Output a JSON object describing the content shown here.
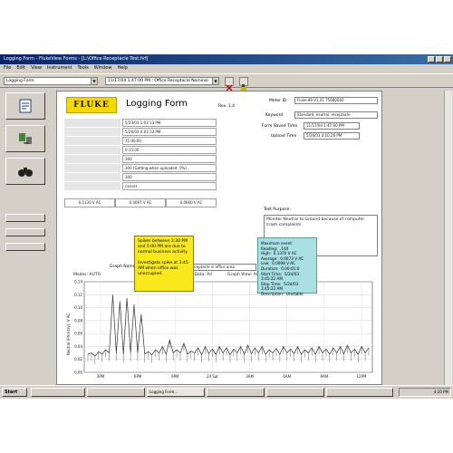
{
  "window": {
    "title": "Logging Form - FlukeView Forms - [L:\\Office Receptacle Test.fvf]"
  },
  "menu": [
    "File",
    "Edit",
    "View",
    "Instrument",
    "Tools",
    "Window",
    "Help"
  ],
  "toolbar": {
    "form_select": "Logging Form",
    "record_select": "11/17/04 1:47:00 PM : Office Receptacle Nominal"
  },
  "form": {
    "brand": "FLUKE",
    "title": "Logging Form",
    "revision": "Rev. 1.4",
    "fields": [
      {
        "label": "",
        "value": "5/23/03 1:03:13 PM"
      },
      {
        "label": "",
        "value": "5/26/03 4:03:13 PM"
      },
      {
        "label": "",
        "value": "71:00:00"
      },
      {
        "label": "",
        "value": "0:15:00"
      },
      {
        "label": "",
        "value": "300"
      },
      {
        "label": "",
        "value": "300     (Getting when uploaded: 0%)"
      },
      {
        "label": "",
        "value": "300"
      },
      {
        "label": "",
        "value": "(none)"
      }
    ],
    "stats": [
      "0.1130 V AC",
      "0.0097 V AC",
      "0.0660 V AC"
    ],
    "meter_id_label": "Meter ID",
    "meter_id": "Fluke 89   V1.01   75660040",
    "keyword_label": "Keyword",
    "keyword": "Standard, neutral, receptacle",
    "form_saved_label": "Form Saved Time",
    "form_saved": "11/17/04 1:47:00 PM",
    "upload_label": "Upload Time",
    "upload": "5/26/03 4:10:26 PM",
    "purpose_label": "Test Purpose:",
    "purpose": "Monitor Neutral to Ground because of computer crash complaints",
    "graph_name_label": "Graph Name:",
    "graph_name": "Neutral to Ground Volts on receptacle in office area",
    "graph_meta_left": "Modes:  AUTO",
    "graph_meta_mid": "Show Data: All",
    "graph_meta_right": "Graph View: All"
  },
  "chart_data": {
    "type": "line",
    "title": "",
    "xlabel": "",
    "ylabel": "Neutral (Primary), V AC",
    "ylim": [
      0.0,
      0.14
    ],
    "yticks": [
      "0.14",
      "0.12",
      "0.10",
      "0.08",
      "0.06",
      "0.04",
      "0.02",
      "0.00"
    ],
    "xticks": [
      "3PM",
      "6PM",
      "9PM",
      "24 Sat",
      "3AM",
      "6AM",
      "9AM",
      "12PM"
    ],
    "series": [
      {
        "name": "",
        "values": [
          0.028,
          0.03,
          0.025,
          0.032,
          0.028,
          0.035,
          0.03,
          0.12,
          0.03,
          0.11,
          0.028,
          0.115,
          0.03,
          0.105,
          0.03,
          0.09,
          0.028,
          0.032,
          0.027,
          0.035,
          0.03,
          0.04,
          0.028,
          0.05,
          0.03,
          0.035,
          0.03,
          0.045,
          0.028,
          0.033,
          0.03,
          0.038,
          0.027,
          0.04,
          0.029,
          0.036,
          0.028,
          0.04,
          0.03,
          0.038,
          0.027,
          0.036,
          0.03,
          0.04,
          0.028,
          0.042,
          0.029,
          0.038,
          0.03,
          0.04,
          0.028,
          0.035,
          0.03,
          0.037,
          0.028,
          0.04,
          0.03,
          0.036,
          0.029,
          0.04,
          0.028,
          0.035,
          0.03,
          0.038,
          0.028,
          0.04,
          0.03,
          0.036,
          0.028,
          0.038,
          0.03,
          0.04,
          0.029,
          0.042,
          0.03,
          0.036,
          0.028,
          0.04,
          0.03,
          0.038
        ]
      }
    ]
  },
  "notes": {
    "yellow": "Spikes between 2:30 PM and 5:00 PM are due to normal business activity.\n\nInvestigate spike at 3:45 AM when office was unoccupied.",
    "cyan": "Maximum event:\nReading:  .140\nHigh:  0.1370 V AC\nAverage:  0.0673 V AC\nLow:  0.0098 V AC\nDuration:  0.00:01:0\nStart Time:  5/24/03 3:45:22 AM\nStop Time:  5/24/03 3:45:22 AM\nDescription:  Unstable"
  },
  "taskbar": {
    "start": "Start",
    "items": [
      "",
      "",
      "Logging Form...",
      "",
      "",
      ""
    ],
    "clock": "4:20 PM"
  },
  "colors": {
    "accent": "#0a246a",
    "brand": "#f5d800",
    "note_yellow": "#f8e81c",
    "note_cyan": "#a8e0e4"
  }
}
